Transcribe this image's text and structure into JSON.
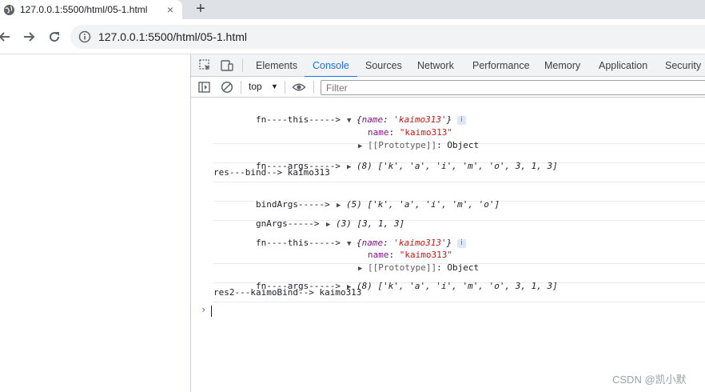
{
  "browser": {
    "tab_title": "127.0.0.1:5500/html/05-1.html",
    "tab_close": "×",
    "new_tab": "+",
    "url": "127.0.0.1:5500/html/05-1.html"
  },
  "devtools": {
    "tabs": [
      "Elements",
      "Console",
      "Sources",
      "Network",
      "Performance",
      "Memory",
      "Application",
      "Security"
    ],
    "active_tab": "Console",
    "context": "top",
    "filter_placeholder": "Filter"
  },
  "console": {
    "entries": [
      {
        "prefix": "fn----this----->",
        "obj_key": "name",
        "obj_val": "'kaimo313'",
        "prop_key": "name",
        "prop_val": "\"kaimo313\"",
        "proto": "[[Prototype]]",
        "proto_val": "Object"
      },
      {
        "prefix": "fn----args----->",
        "count": "(8)",
        "values": "['k', 'a', 'i', 'm', 'o', 3, 1, 3]"
      },
      {
        "text": "res---bind--> kaimo313"
      },
      {
        "prefix": "bindArgs----->",
        "count": "(5)",
        "values": "['k', 'a', 'i', 'm', 'o']"
      },
      {
        "prefix": "gnArgs----->",
        "count": "(3)",
        "values": "[3, 1, 3]"
      },
      {
        "prefix": "fn----this----->",
        "obj_key": "name",
        "obj_val": "'kaimo313'",
        "prop_key": "name",
        "prop_val": "\"kaimo313\"",
        "proto": "[[Prototype]]",
        "proto_val": "Object"
      },
      {
        "prefix": "fn----args----->",
        "count": "(8)",
        "values": "['k', 'a', 'i', 'm', 'o', 3, 1, 3]"
      },
      {
        "text": "res2---kaimoBind--> kaimo313"
      }
    ],
    "prompt_symbol": "›"
  },
  "watermark": "CSDN @凯小默"
}
